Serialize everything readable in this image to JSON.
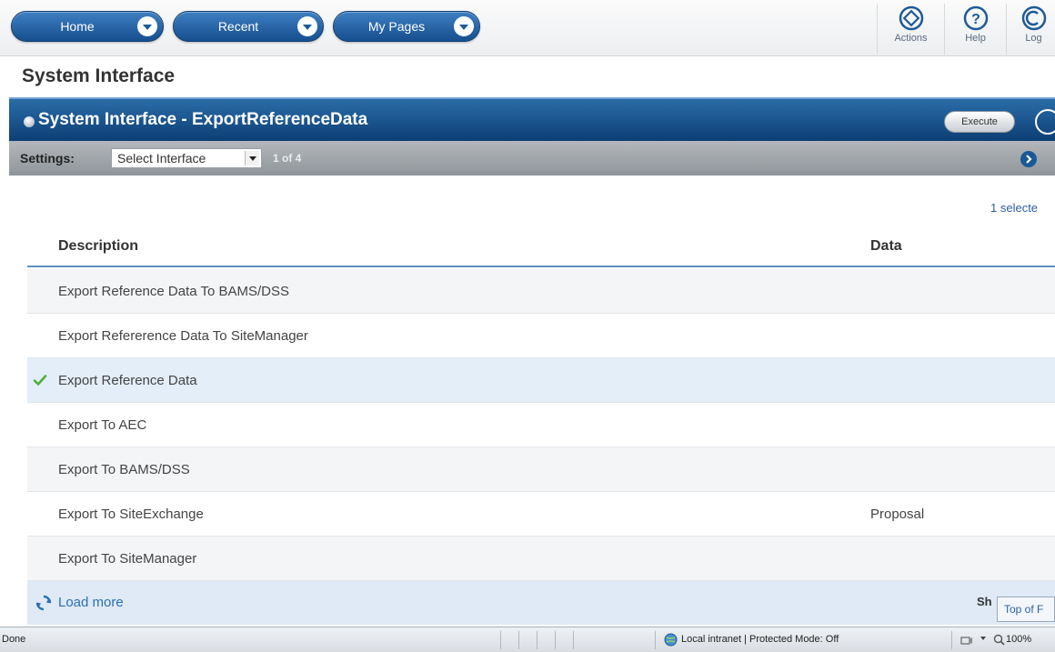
{
  "nav": {
    "home_label": "Home",
    "recent_label": "Recent",
    "my_pages_label": "My Pages",
    "actions_label": "Actions",
    "help_label": "Help",
    "logout_label": "Log"
  },
  "page": {
    "title": "System Interface"
  },
  "panel": {
    "title": "System Interface - ExportReferenceData",
    "execute_label": "Execute"
  },
  "settings": {
    "label": "Settings:",
    "select_value": "Select Interface",
    "page_count": "1 of 4"
  },
  "selection": {
    "count_text": "1 selecte"
  },
  "table": {
    "columns": [
      "Description",
      "Data"
    ],
    "rows": [
      {
        "description": "Export Reference Data To BAMS/DSS",
        "data": "",
        "selected": false
      },
      {
        "description": "Export Refererence Data To SiteManager",
        "data": "",
        "selected": false
      },
      {
        "description": "Export Reference Data",
        "data": "",
        "selected": true
      },
      {
        "description": "Export To AEC",
        "data": "",
        "selected": false
      },
      {
        "description": "Export To BAMS/DSS",
        "data": "",
        "selected": false
      },
      {
        "description": "Export To SiteExchange",
        "data": "Proposal",
        "selected": false
      },
      {
        "description": "Export To SiteManager",
        "data": "",
        "selected": false
      }
    ]
  },
  "footer": {
    "load_more_label": "Load more",
    "show_label": "Sh",
    "tooltip": "Top of F"
  },
  "statusbar": {
    "status": "Done",
    "zone": "Local intranet | Protected Mode: Off",
    "zoom": "100%"
  },
  "colors": {
    "nav_button": "#1d5a99",
    "panel_header": "#0d3f74",
    "selected_row": "#e3eef9",
    "check": "#4caf3c",
    "link": "#2b6fb5"
  },
  "icons": [
    "chevron-down-icon",
    "actions-icon",
    "help-icon",
    "logout-icon",
    "check-icon",
    "refresh-icon",
    "next-arrow-icon",
    "globe-icon",
    "zoom-icon"
  ]
}
